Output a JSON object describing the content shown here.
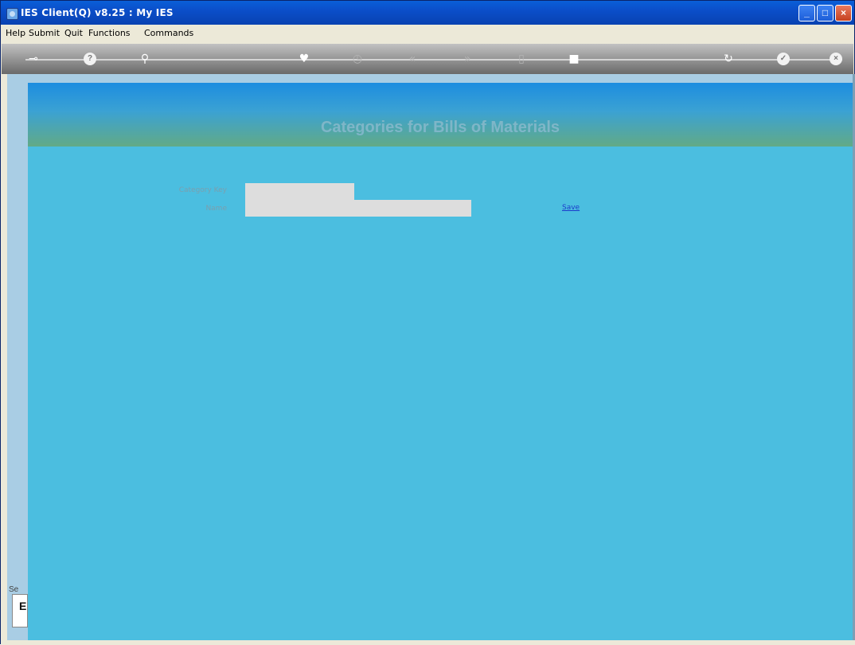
{
  "window": {
    "title": "IES Client(Q) v8.25 : My IES",
    "controls": {
      "minimize": "_",
      "maximize": "□",
      "close": "×"
    }
  },
  "menu": {
    "items": [
      {
        "label": "Help"
      },
      {
        "label": "Submit"
      },
      {
        "label": "Quit"
      },
      {
        "label": "Functions"
      },
      {
        "label": "Commands"
      }
    ]
  },
  "toolbar": {
    "icons": [
      {
        "name": "key-icon",
        "glyph": "⊸"
      },
      {
        "name": "help-icon",
        "glyph": "?"
      },
      {
        "name": "search-icon",
        "glyph": "⚲"
      },
      {
        "name": "heart-icon",
        "glyph": "♥"
      },
      {
        "name": "clock-icon",
        "glyph": "◷"
      },
      {
        "name": "previous-icon",
        "glyph": "«"
      },
      {
        "name": "next-icon",
        "glyph": "»"
      },
      {
        "name": "document-icon",
        "glyph": "▯"
      },
      {
        "name": "stop-icon",
        "glyph": "■"
      },
      {
        "name": "refresh-icon",
        "glyph": "↻"
      },
      {
        "name": "check-icon",
        "glyph": "✓"
      },
      {
        "name": "close-icon",
        "glyph": "×"
      }
    ]
  },
  "form": {
    "title": "Categories for Bills of Materials",
    "fields": [
      {
        "label": "Category Key",
        "value": ""
      },
      {
        "label": "Name",
        "value": ""
      }
    ],
    "save_label": "Save"
  },
  "side": {
    "label": "Se",
    "box_text": "E"
  },
  "colors": {
    "panel": "#4bbee0",
    "banner_top": "#1d8de0",
    "banner_bottom": "#62aa86",
    "outer": "#a9cde4",
    "input": "#dddddd",
    "link": "#1c3ccb"
  }
}
